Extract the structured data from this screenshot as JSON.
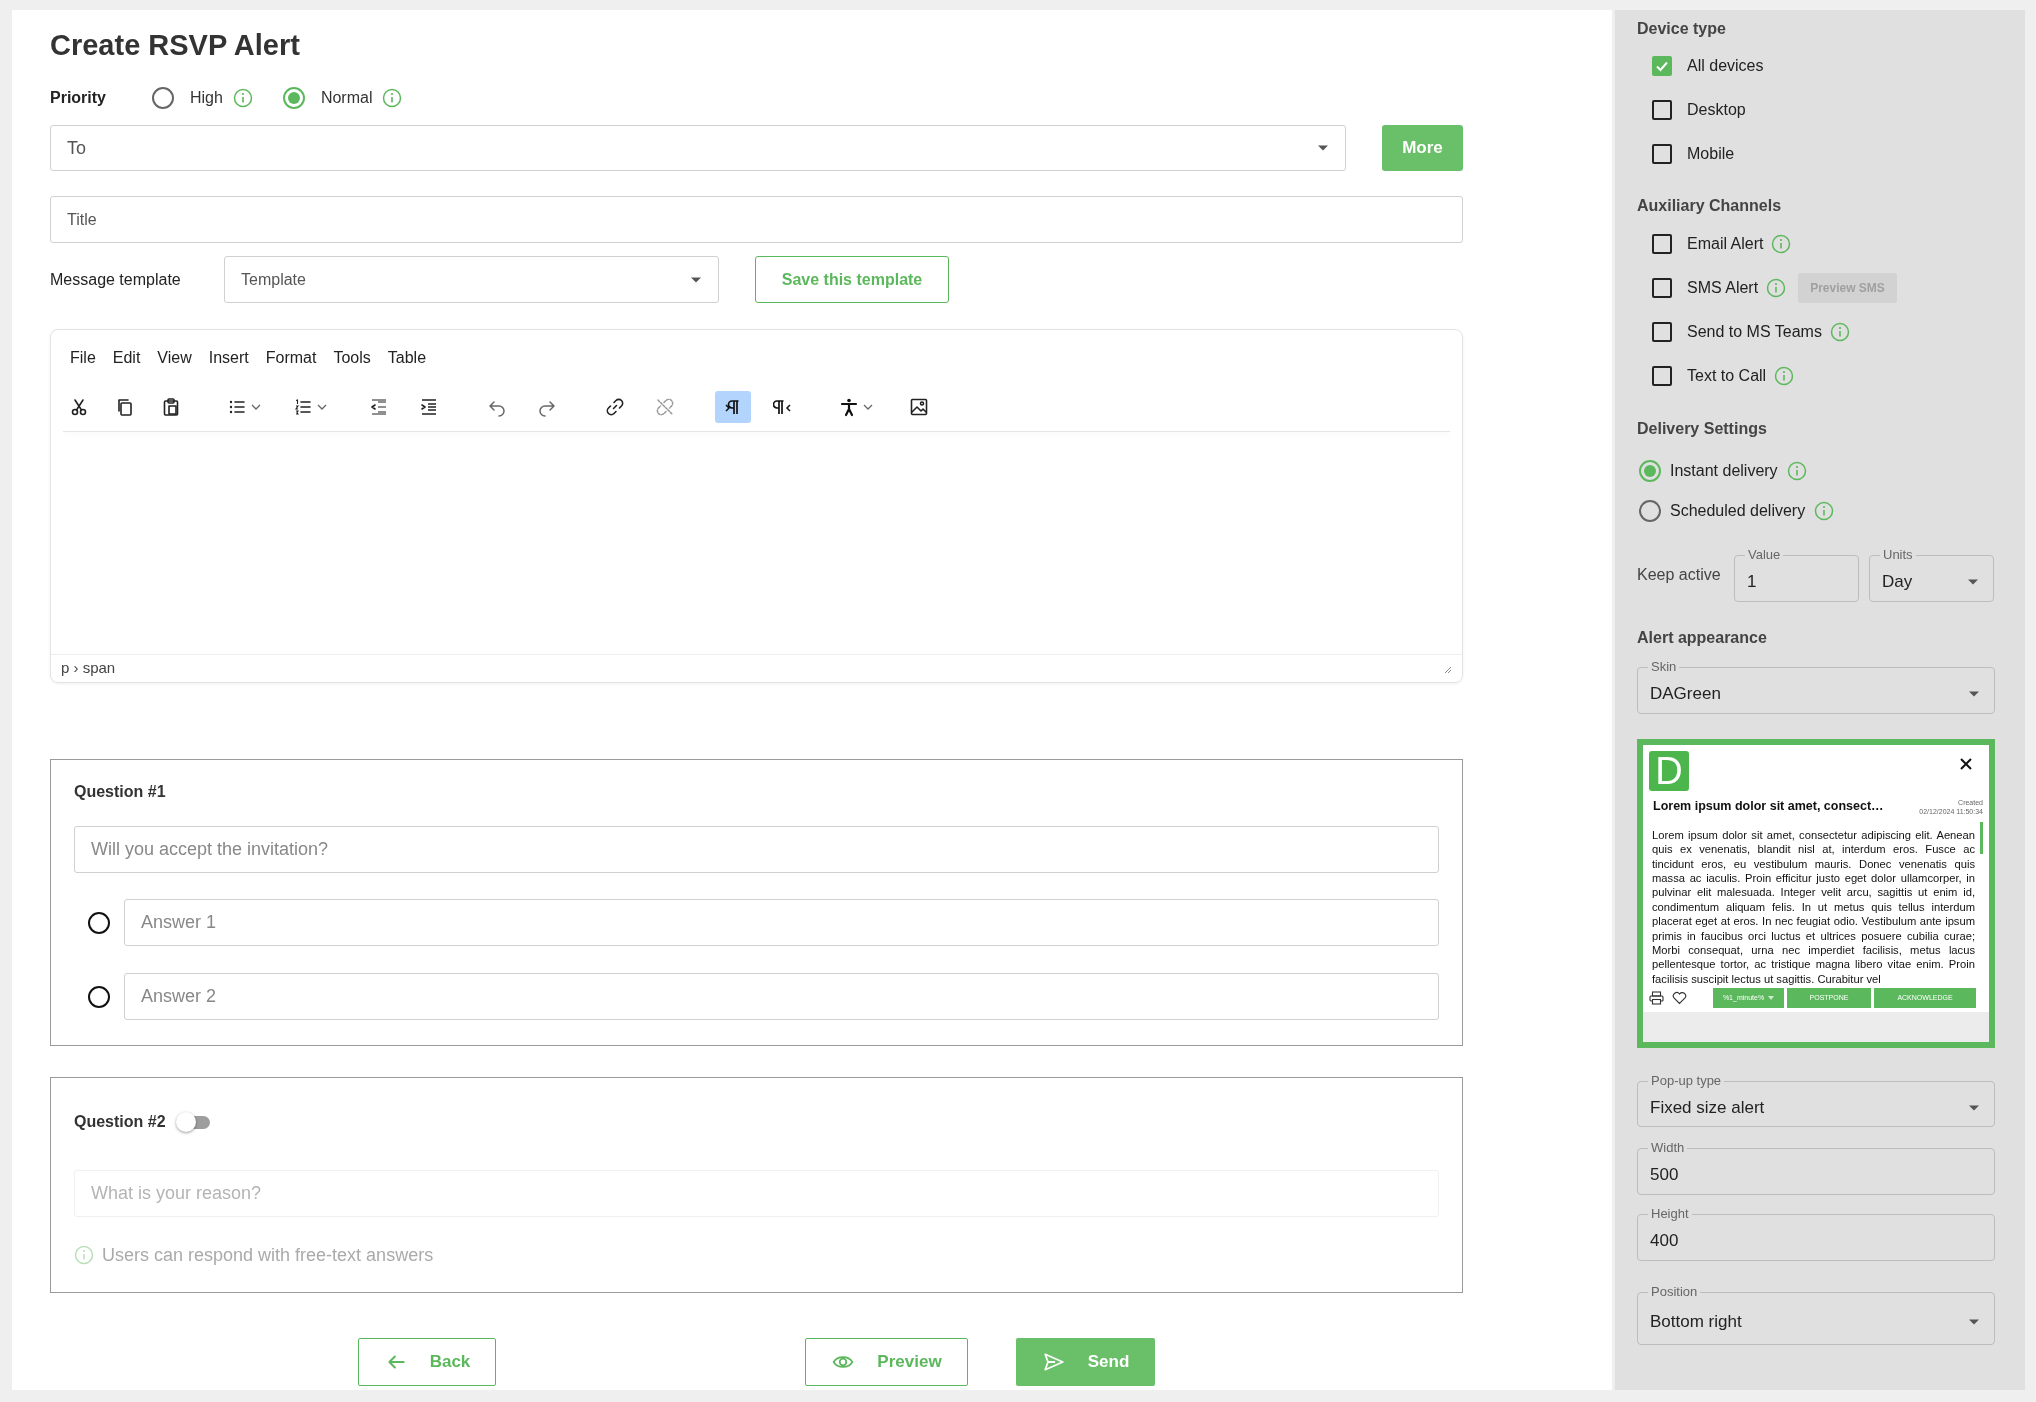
{
  "page": {
    "title": "Create RSVP Alert"
  },
  "priority": {
    "label": "Priority",
    "options": [
      {
        "label": "High",
        "selected": false
      },
      {
        "label": "Normal",
        "selected": true
      }
    ]
  },
  "to_field": {
    "placeholder": "To"
  },
  "more_button": "More",
  "title_field": {
    "placeholder": "Title"
  },
  "message_template": {
    "label": "Message template",
    "placeholder": "Template",
    "save_button": "Save this template"
  },
  "editor": {
    "menu": [
      "File",
      "Edit",
      "View",
      "Insert",
      "Format",
      "Tools",
      "Table"
    ],
    "toolbar": [
      {
        "selected": false
      },
      {
        "selected": false
      },
      {
        "selected": false
      },
      {
        "selected": false
      },
      {
        "selected": false
      },
      {
        "selected": false
      },
      {
        "selected": false
      },
      {
        "selected": false
      },
      {
        "selected": false
      },
      {
        "selected": false
      },
      {
        "selected": false
      },
      {
        "selected": true
      },
      {
        "selected": false
      },
      {
        "selected": false
      },
      {
        "selected": false
      }
    ],
    "status_path": "p › span"
  },
  "questions": [
    {
      "title": "Question #1",
      "kind": "choice",
      "field": {
        "placeholder": "Will you accept the invitation?"
      },
      "answers": [
        {
          "placeholder": "Answer 1",
          "selected": false
        },
        {
          "placeholder": "Answer 2",
          "selected": false
        }
      ]
    },
    {
      "title": "Question #2",
      "kind": "free_text",
      "on": false,
      "field": {
        "placeholder": "What is your reason?"
      },
      "hint": "Users can respond with free-text answers"
    }
  ],
  "actions": [
    {
      "label": "Back",
      "kind": "outline"
    },
    {
      "label": "Preview",
      "kind": "outline"
    },
    {
      "label": "Send",
      "kind": "filled"
    }
  ],
  "sidebar": {
    "device_type": {
      "heading": "Device type",
      "options": [
        {
          "label": "All devices",
          "checked": true
        },
        {
          "label": "Desktop",
          "checked": false
        },
        {
          "label": "Mobile",
          "checked": false
        }
      ]
    },
    "auxiliary_channels": {
      "heading": "Auxiliary Channels",
      "options": [
        {
          "label": "Email Alert",
          "checked": false
        },
        {
          "label": "SMS Alert",
          "checked": false,
          "action": {
            "label": "Preview SMS",
            "disabled": true
          }
        },
        {
          "label": "Send to MS Teams",
          "checked": false
        },
        {
          "label": "Text to Call",
          "checked": false
        }
      ]
    },
    "delivery_settings": {
      "heading": "Delivery Settings",
      "options": [
        {
          "label": "Instant delivery",
          "selected": true
        },
        {
          "label": "Scheduled delivery",
          "selected": false
        }
      ],
      "keep_active": {
        "label": "Keep active",
        "value_field": {
          "label": "Value",
          "value": "1"
        },
        "units_field": {
          "label": "Units",
          "value": "Day",
          "kind": "select"
        }
      }
    },
    "alert_appearance": {
      "heading": "Alert appearance",
      "skin": {
        "label": "Skin",
        "value": "DAGreen",
        "kind": "select"
      },
      "preview": {
        "logo_letter": "D",
        "created_label": "Created",
        "created_at": "02/12/2024 11:50:34",
        "title": "Lorem ipsum dolor sit amet, consect…",
        "body": "Lorem ipsum dolor sit amet, consectetur adipiscing elit. Aenean quis ex venenatis, blandit nisl at, interdum eros. Fusce ac tincidunt eros, eu vestibulum mauris. Donec venenatis quis massa ac iaculis. Proin efficitur justo eget dolor ullamcorper, in pulvinar elit malesuada. Integer velit arcu, sagittis ut enim id, condimentum aliquam felis. In ut metus quis tellus interdum placerat eget at eros. In nec feugiat odio. Vestibulum ante ipsum primis in faucibus orci luctus et ultrices posuere cubilia curae; Morbi consequat, urna nec imperdiet facilisis, metus lacus pellentesque tortor, ac tristique magna libero vitae enim. Proin facilisis suscipit lectus ut sagittis. Curabitur vel",
        "buttons": [
          {
            "label": "%1_minute%",
            "kind": "dropdown"
          },
          {
            "label": "POSTPONE",
            "kind": "plain"
          },
          {
            "label": "ACKNOWLEDGE",
            "kind": "plain"
          }
        ]
      },
      "popup_type": {
        "label": "Pop-up type",
        "value": "Fixed size alert",
        "kind": "select"
      },
      "width": {
        "label": "Width",
        "value": "500"
      },
      "height": {
        "label": "Height",
        "value": "400"
      },
      "position": {
        "label": "Position",
        "value": "Bottom right",
        "kind": "select"
      }
    }
  }
}
